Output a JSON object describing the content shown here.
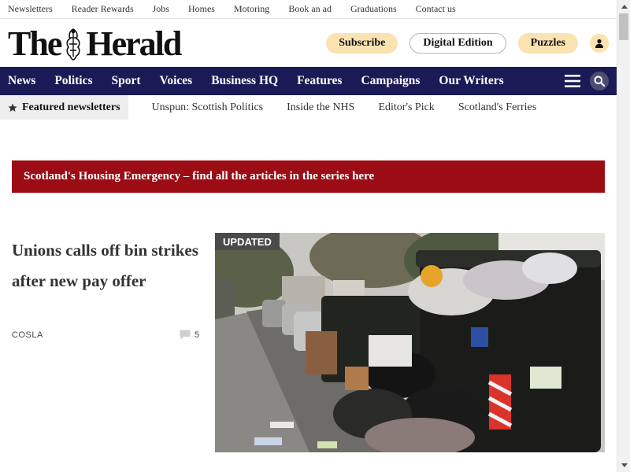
{
  "utility_nav": [
    "Newsletters",
    "Reader Rewards",
    "Jobs",
    "Homes",
    "Motoring",
    "Book an ad",
    "Graduations",
    "Contact us"
  ],
  "masthead": {
    "logo_left": "The",
    "logo_right": "Herald",
    "subscribe": "Subscribe",
    "digital_edition": "Digital Edition",
    "puzzles": "Puzzles",
    "user_icon": "user-icon"
  },
  "main_nav": [
    "News",
    "Politics",
    "Sport",
    "Voices",
    "Business HQ",
    "Features",
    "Campaigns",
    "Our Writers"
  ],
  "newsletters": {
    "featured_label": "Featured newsletters",
    "items": [
      "Unspun: Scottish Politics",
      "Inside the NHS",
      "Editor's Pick",
      "Scotland's Ferries"
    ]
  },
  "banner": {
    "text": "Scotland's Housing Emergency – find all the articles in the series here"
  },
  "story": {
    "headline": "Unions calls off bin strikes after new pay offer",
    "tag": "COSLA",
    "comment_count": "5",
    "badge": "UPDATED"
  },
  "colors": {
    "nav_bg": "#1a1a56",
    "banner_bg": "#9b0c14",
    "pill_yellow": "#fbe3b1",
    "badge_bg": "#4a4a4a"
  }
}
